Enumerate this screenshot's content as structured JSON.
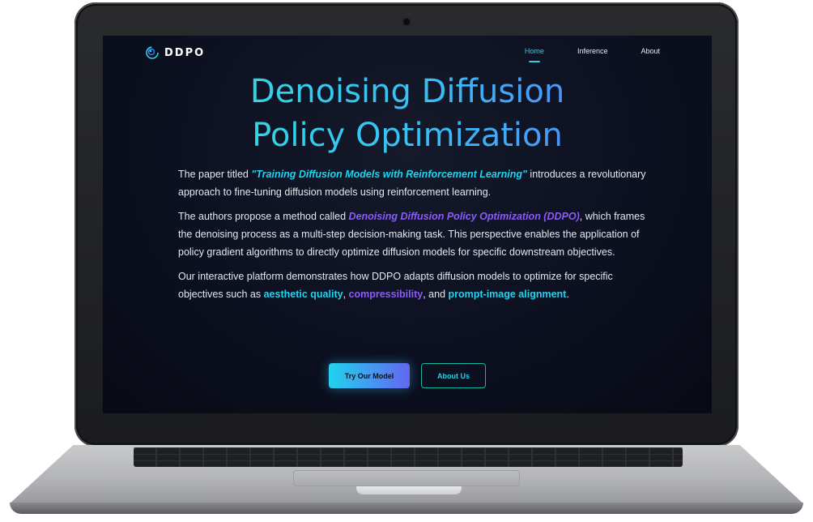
{
  "nav": {
    "brand": "DDPO",
    "links": [
      {
        "label": "Home",
        "active": true
      },
      {
        "label": "Inference",
        "active": false
      },
      {
        "label": "About",
        "active": false
      }
    ]
  },
  "hero": {
    "title_line1": "Denoising Diffusion",
    "title_line2": "Policy Optimization"
  },
  "content": {
    "p1": {
      "before": "The paper titled ",
      "highlight": "\"Training Diffusion Models with Reinforcement Learning\"",
      "after": " introduces a revolutionary approach to fine-tuning diffusion models using reinforcement learning."
    },
    "p2": {
      "before": "The authors propose a method called ",
      "highlight": "Denoising Diffusion Policy Optimization (DDPO)",
      "after": ", which frames the denoising process as a multi-step decision-making task. This perspective enables the application of policy gradient algorithms to directly optimize diffusion models for specific downstream objectives."
    },
    "p3": {
      "before": "Our interactive platform demonstrates how DDPO adapts diffusion models to optimize for specific objectives such as ",
      "term1": "aesthetic quality",
      "sep1": ", ",
      "term2": "compressibility",
      "sep2": ", and ",
      "term3": "prompt-image alignment",
      "after": "."
    }
  },
  "buttons": {
    "primary": "Try Our Model",
    "secondary": "About Us"
  },
  "colors": {
    "accent_cyan": "#22d3ee",
    "accent_purple": "#8b5cf6",
    "background": "#0c1020"
  },
  "icons": {
    "logo": "spiral-logo-icon"
  }
}
